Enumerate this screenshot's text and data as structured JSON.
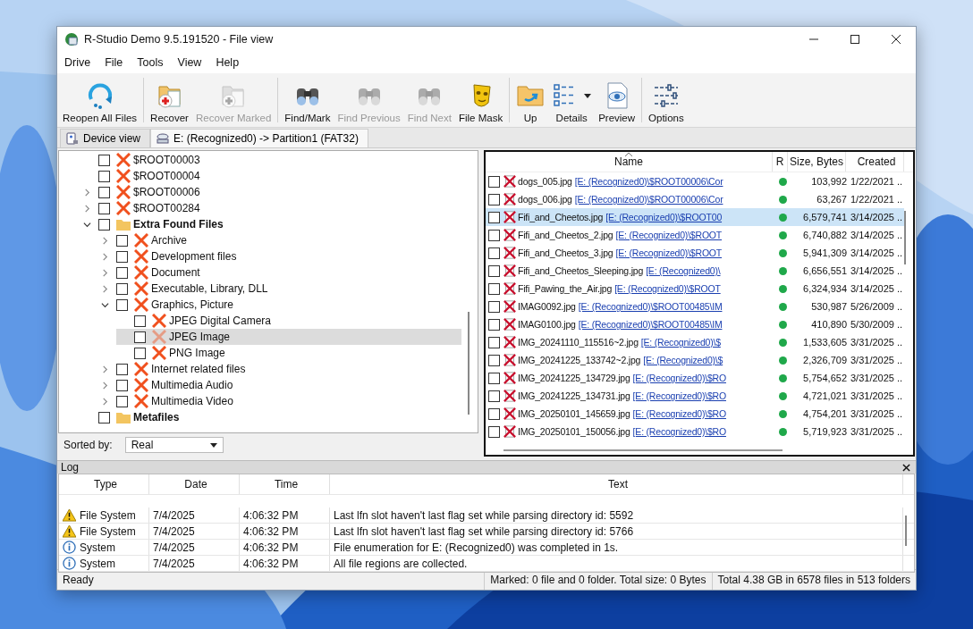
{
  "window": {
    "title": "R-Studio Demo 9.5.191520 - File view"
  },
  "menu": [
    "Drive",
    "File",
    "Tools",
    "View",
    "Help"
  ],
  "toolbar": [
    [
      {
        "label": "Reopen All Files",
        "kind": "refresh",
        "disabled": false,
        "dropdown": false
      }
    ],
    [
      {
        "label": "Recover",
        "kind": "recover",
        "disabled": false,
        "dropdown": false
      },
      {
        "label": "Recover Marked",
        "kind": "recover",
        "disabled": true,
        "dropdown": false
      }
    ],
    [
      {
        "label": "Find/Mark",
        "kind": "find",
        "disabled": false,
        "dropdown": false
      },
      {
        "label": "Find Previous",
        "kind": "find",
        "disabled": true,
        "dropdown": false
      },
      {
        "label": "Find Next",
        "kind": "find",
        "disabled": true,
        "dropdown": false
      },
      {
        "label": "File Mask",
        "kind": "mask",
        "disabled": false,
        "dropdown": false
      }
    ],
    [
      {
        "label": "Up",
        "kind": "up",
        "disabled": false,
        "dropdown": false
      },
      {
        "label": "Details",
        "kind": "details",
        "disabled": false,
        "dropdown": true
      },
      {
        "label": "Preview",
        "kind": "preview",
        "disabled": false,
        "dropdown": false
      }
    ],
    [
      {
        "label": "Options",
        "kind": "options",
        "disabled": false,
        "dropdown": false
      }
    ]
  ],
  "tabs": [
    {
      "label": "Device view",
      "kind": "device",
      "selected": false
    },
    {
      "label": "E: (Recognized0) -> Partition1 (FAT32)",
      "kind": "partition",
      "selected": true
    }
  ],
  "tree": [
    {
      "label": "$ROOT00003",
      "kind": "deleted",
      "leaf": true,
      "expanded": false,
      "checked": false,
      "selected": false
    },
    {
      "label": "$ROOT00004",
      "kind": "deleted",
      "leaf": true,
      "expanded": false,
      "checked": false,
      "selected": false
    },
    {
      "label": "$ROOT00006",
      "kind": "deleted",
      "leaf": false,
      "expanded": false,
      "checked": false,
      "selected": false
    },
    {
      "label": "$ROOT00284",
      "kind": "deleted",
      "leaf": false,
      "expanded": false,
      "checked": false,
      "selected": false
    },
    {
      "label": "Extra Found Files",
      "kind": "folder",
      "leaf": false,
      "expanded": true,
      "checked": false,
      "selected": false,
      "children": [
        {
          "label": "Archive",
          "kind": "deleted",
          "leaf": false,
          "expanded": false,
          "checked": false,
          "selected": false
        },
        {
          "label": "Development files",
          "kind": "deleted",
          "leaf": false,
          "expanded": false,
          "checked": false,
          "selected": false
        },
        {
          "label": "Document",
          "kind": "deleted",
          "leaf": false,
          "expanded": false,
          "checked": false,
          "selected": false
        },
        {
          "label": "Executable, Library, DLL",
          "kind": "deleted",
          "leaf": false,
          "expanded": false,
          "checked": false,
          "selected": false
        },
        {
          "label": "Graphics, Picture",
          "kind": "deleted",
          "leaf": false,
          "expanded": true,
          "checked": false,
          "selected": false,
          "children": [
            {
              "label": "JPEG Digital Camera",
              "kind": "deleted",
              "leaf": true,
              "expanded": false,
              "checked": false,
              "selected": false
            },
            {
              "label": "JPEG Image",
              "kind": "deleted",
              "leaf": true,
              "expanded": false,
              "checked": false,
              "selected": true
            },
            {
              "label": "PNG Image",
              "kind": "deleted",
              "leaf": true,
              "expanded": false,
              "checked": false,
              "selected": false
            }
          ]
        },
        {
          "label": "Internet related files",
          "kind": "deleted",
          "leaf": false,
          "expanded": false,
          "checked": false,
          "selected": false
        },
        {
          "label": "Multimedia Audio",
          "kind": "deleted",
          "leaf": false,
          "expanded": false,
          "checked": false,
          "selected": false
        },
        {
          "label": "Multimedia Video",
          "kind": "deleted",
          "leaf": false,
          "expanded": false,
          "checked": false,
          "selected": false
        }
      ]
    },
    {
      "label": "Metafiles",
      "kind": "folder",
      "leaf": true,
      "expanded": false,
      "checked": false,
      "selected": false
    }
  ],
  "sort": {
    "label": "Sorted by:",
    "value": "Real"
  },
  "file_columns": [
    "Name",
    "R",
    "Size, Bytes",
    "Created"
  ],
  "files": [
    {
      "name": "dogs_005.jpg",
      "path": "[E: (Recognized0)\\$ROOT00006\\Cor",
      "size": "103,992",
      "created": "1/22/2021 ..",
      "checked": false,
      "selected": false
    },
    {
      "name": "dogs_006.jpg",
      "path": "[E: (Recognized0)\\$ROOT00006\\Cor",
      "size": "63,267",
      "created": "1/22/2021 ..",
      "checked": false,
      "selected": false
    },
    {
      "name": "Fifi_and_Cheetos.jpg",
      "path": "[E: (Recognized0)\\$ROOT00",
      "size": "6,579,741",
      "created": "3/14/2025 ..",
      "checked": false,
      "selected": true
    },
    {
      "name": "Fifi_and_Cheetos_2.jpg",
      "path": "[E: (Recognized0)\\$ROOT",
      "size": "6,740,882",
      "created": "3/14/2025 ..",
      "checked": false,
      "selected": false
    },
    {
      "name": "Fifi_and_Cheetos_3.jpg",
      "path": "[E: (Recognized0)\\$ROOT",
      "size": "5,941,309",
      "created": "3/14/2025 ..",
      "checked": false,
      "selected": false
    },
    {
      "name": "Fifi_and_Cheetos_Sleeping.jpg",
      "path": "[E: (Recognized0)\\",
      "size": "6,656,551",
      "created": "3/14/2025 ..",
      "checked": false,
      "selected": false
    },
    {
      "name": "Fifi_Pawing_the_Air.jpg",
      "path": "[E: (Recognized0)\\$ROOT",
      "size": "6,324,934",
      "created": "3/14/2025 ..",
      "checked": false,
      "selected": false
    },
    {
      "name": "IMAG0092.jpg",
      "path": "[E: (Recognized0)\\$ROOT00485\\IM",
      "size": "530,987",
      "created": "5/26/2009 ..",
      "checked": false,
      "selected": false
    },
    {
      "name": "IMAG0100.jpg",
      "path": "[E: (Recognized0)\\$ROOT00485\\IM",
      "size": "410,890",
      "created": "5/30/2009 ..",
      "checked": false,
      "selected": false
    },
    {
      "name": "IMG_20241110_115516~2.jpg",
      "path": "[E: (Recognized0)\\$",
      "size": "1,533,605",
      "created": "3/31/2025 ..",
      "checked": false,
      "selected": false
    },
    {
      "name": "IMG_20241225_133742~2.jpg",
      "path": "[E: (Recognized0)\\$",
      "size": "2,326,709",
      "created": "3/31/2025 ..",
      "checked": false,
      "selected": false
    },
    {
      "name": "IMG_20241225_134729.jpg",
      "path": "[E: (Recognized0)\\$RO",
      "size": "5,754,652",
      "created": "3/31/2025 ..",
      "checked": false,
      "selected": false
    },
    {
      "name": "IMG_20241225_134731.jpg",
      "path": "[E: (Recognized0)\\$RO",
      "size": "4,721,021",
      "created": "3/31/2025 ..",
      "checked": false,
      "selected": false
    },
    {
      "name": "IMG_20250101_145659.jpg",
      "path": "[E: (Recognized0)\\$RO",
      "size": "4,754,201",
      "created": "3/31/2025 ..",
      "checked": false,
      "selected": false
    },
    {
      "name": "IMG_20250101_150056.jpg",
      "path": "[E: (Recognized0)\\$RO",
      "size": "5,719,923",
      "created": "3/31/2025 ..",
      "checked": false,
      "selected": false
    }
  ],
  "log": {
    "title": "Log",
    "columns": [
      "Type",
      "Date",
      "Time",
      "Text"
    ],
    "rows": [
      {
        "kind": "warning",
        "type": "File System",
        "date": "7/4/2025",
        "time": "4:06:32 PM",
        "text": "Last lfn slot haven't last flag set while parsing directory id: 5592"
      },
      {
        "kind": "warning",
        "type": "File System",
        "date": "7/4/2025",
        "time": "4:06:32 PM",
        "text": "Last lfn slot haven't last flag set while parsing directory id: 5766"
      },
      {
        "kind": "info",
        "type": "System",
        "date": "7/4/2025",
        "time": "4:06:32 PM",
        "text": "File enumeration for E: (Recognized0) was completed in 1s."
      },
      {
        "kind": "info",
        "type": "System",
        "date": "7/4/2025",
        "time": "4:06:32 PM",
        "text": "All file regions are collected."
      }
    ]
  },
  "status_bar": [
    "Ready",
    "Marked: 0 file and 0 folder. Total size: 0 Bytes",
    "Total 4.38 GB in 6578 files in 513 folders"
  ]
}
